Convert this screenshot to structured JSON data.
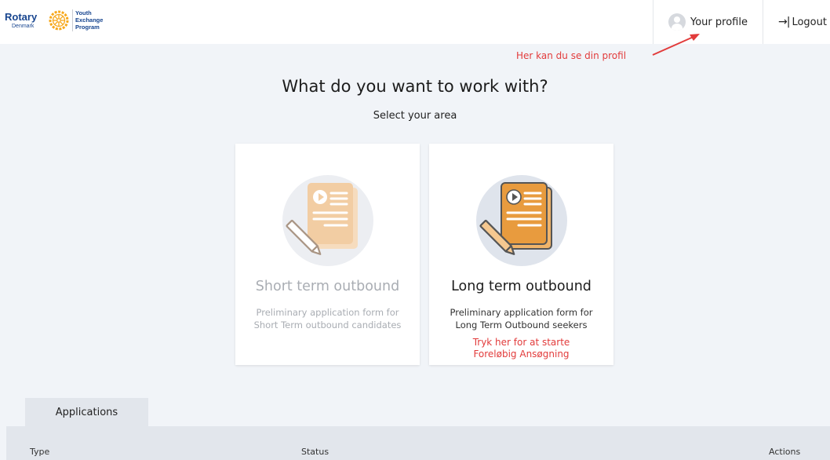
{
  "header": {
    "logo": {
      "brand": "Rotary",
      "country": "Denmark",
      "program_lines": [
        "Youth",
        "Exchange",
        "Program"
      ]
    },
    "profile_label": "Your profile",
    "logout_label": "Logout",
    "logout_icon": "→|"
  },
  "annotations": {
    "profile_hint": "Her kan du se din profil",
    "long_term_hint_lines": [
      "Tryk her for at starte",
      "Foreløbig Ansøgning"
    ],
    "color": "#e23b3b"
  },
  "main": {
    "title": "What do you want to work with?",
    "subtitle": "Select your area",
    "cards": [
      {
        "title": "Short term outbound",
        "description_lines": [
          "Preliminary application form for",
          "Short Term outbound candidates"
        ],
        "state": "disabled",
        "icon": "document-pencil-icon"
      },
      {
        "title": "Long term outbound",
        "description_lines": [
          "Preliminary application form for",
          "Long Term Outbound seekers"
        ],
        "state": "active",
        "icon": "document-pencil-icon"
      }
    ]
  },
  "applications": {
    "tab_label": "Applications",
    "columns": [
      "Type",
      "Status",
      "Actions"
    ]
  },
  "colors": {
    "background": "#f1f4f8",
    "brand_blue": "#17458f",
    "brand_gold": "#f7a81b",
    "accent_orange": "#e89b3e",
    "accent_orange_light": "#f2cda3",
    "disabled_text": "#a9adb3",
    "panel": "#e2e6ec"
  }
}
